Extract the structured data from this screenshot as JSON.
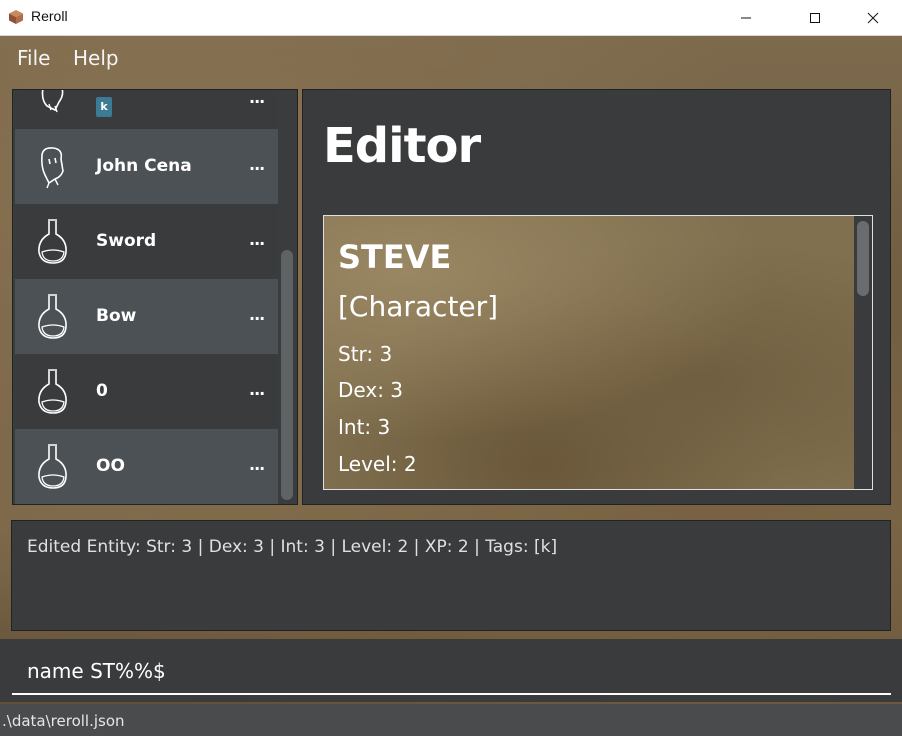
{
  "window": {
    "title": "Reroll"
  },
  "menu": {
    "file": "File",
    "help": "Help"
  },
  "list": {
    "items": [
      {
        "name": "",
        "icon": "ghost-icon",
        "tag": "k",
        "more": "..."
      },
      {
        "name": "John Cena",
        "icon": "ghost-icon",
        "more": "..."
      },
      {
        "name": "Sword",
        "icon": "potion-icon",
        "more": "..."
      },
      {
        "name": "Bow",
        "icon": "potion-icon",
        "more": "..."
      },
      {
        "name": "0",
        "icon": "potion-icon",
        "more": "..."
      },
      {
        "name": "OO",
        "icon": "potion-icon",
        "more": "..."
      }
    ]
  },
  "editor": {
    "title": "Editor",
    "card": {
      "name": "STEVE",
      "type": "[Character]",
      "str": "Str: 3",
      "dex": "Dex: 3",
      "int": "Int: 3",
      "level": "Level: 2"
    }
  },
  "result": {
    "text": "Edited Entity: Str: 3 | Dex: 3 | Int: 3 | Level: 2 | XP: 2 | Tags: [k]"
  },
  "command": {
    "value": "name ST%%$"
  },
  "status": {
    "path": ".\\data\\reroll.json"
  },
  "colors": {
    "panel": "#3a3b3c",
    "list_alt": "#4c5155",
    "tag": "#3d7a94"
  }
}
